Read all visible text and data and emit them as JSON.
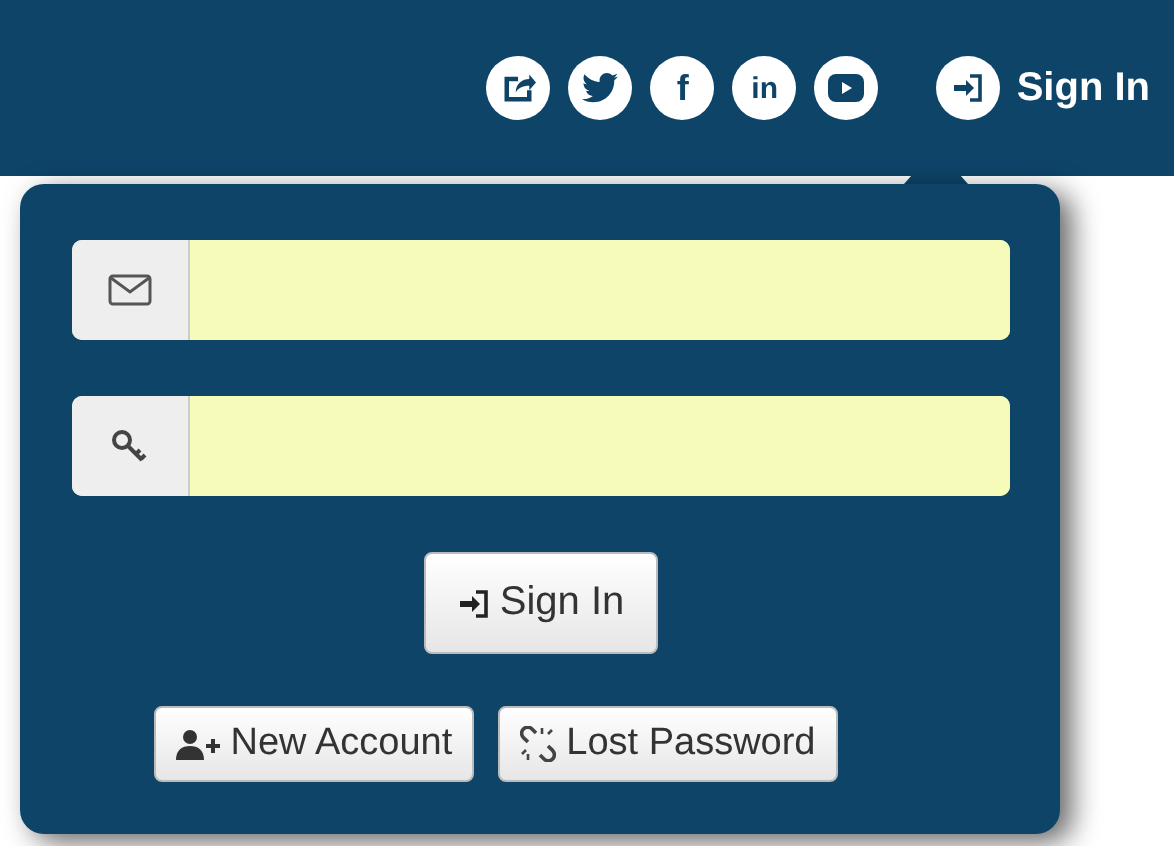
{
  "header": {
    "social_icons": [
      {
        "kind": "share"
      },
      {
        "kind": "twitter"
      },
      {
        "kind": "facebook",
        "glyph": "f"
      },
      {
        "kind": "linkedin",
        "glyph": "in"
      },
      {
        "kind": "youtube"
      }
    ],
    "sign_in_link": "Sign In"
  },
  "login_popup": {
    "fields": [
      {
        "kind": "email"
      },
      {
        "kind": "password"
      }
    ],
    "submit_button": "Sign In",
    "links": [
      {
        "kind": "new-account",
        "label": "New Account"
      },
      {
        "kind": "lost-password",
        "label": "Lost Password"
      }
    ]
  }
}
